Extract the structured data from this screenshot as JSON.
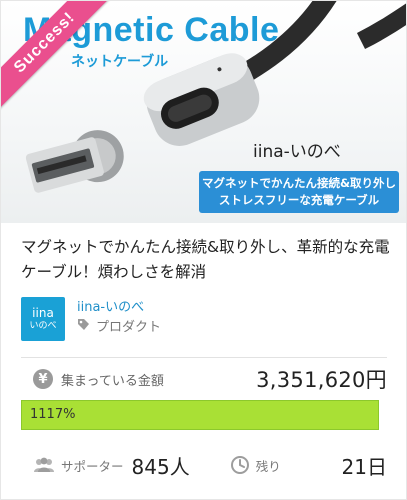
{
  "hero": {
    "title": "Magnetic Cable",
    "subtitle": "ネットケーブル",
    "ribbon": "Success!",
    "brand_mark": "iina-いのべ",
    "callout_line1": "マグネットでかんたん接続&取り外し",
    "callout_line2": "ストレスフリーな充電ケーブル"
  },
  "project": {
    "title": "マグネットでかんたん接続&取り外し、革新的な充電ケーブル！煩わしさを解消"
  },
  "owner": {
    "logo_line1": "iina",
    "logo_line2": "いのべ",
    "name": "iina-いのべ",
    "category": "プロダクト"
  },
  "funding": {
    "amount_label": "集まっている金額",
    "amount_value": "3,351,620円",
    "progress_text": "1117%",
    "progress_fraction": 1.0
  },
  "stats": {
    "supporters_label": "サポーター",
    "supporters_value": "845人",
    "remaining_label": "残り",
    "remaining_value": "21日"
  },
  "colors": {
    "accent_blue": "#1d9bd7",
    "ribbon_pink": "#ea4f8e",
    "progress_green": "#a9e035",
    "owner_link": "#1f8fc9"
  }
}
